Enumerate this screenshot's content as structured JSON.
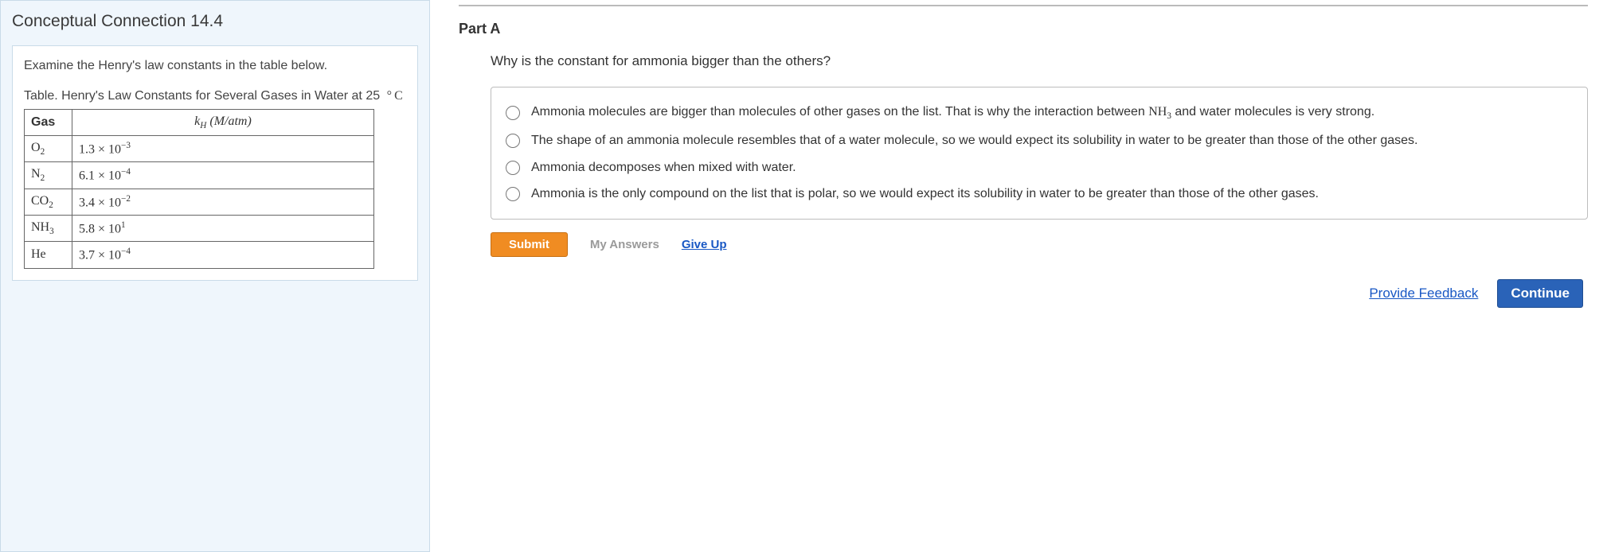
{
  "left": {
    "title": "Conceptual Connection 14.4",
    "instruction": "Examine the Henry's law constants in the table below.",
    "table_caption_prefix": "Table. Henry's Law Constants for Several Gases in Water at 25",
    "table_caption_unit": "°C",
    "headers": {
      "gas": "Gas",
      "kh": "kH (M/atm)"
    },
    "rows": [
      {
        "gas_base": "O",
        "gas_sub": "2",
        "val_coef": "1.3",
        "val_exp": "−3"
      },
      {
        "gas_base": "N",
        "gas_sub": "2",
        "val_coef": "6.1",
        "val_exp": "−4"
      },
      {
        "gas_base": "CO",
        "gas_sub": "2",
        "val_coef": "3.4",
        "val_exp": "−2"
      },
      {
        "gas_base": "NH",
        "gas_sub": "3",
        "val_coef": "5.8",
        "val_exp": "1"
      },
      {
        "gas_base": "He",
        "gas_sub": "",
        "val_coef": "3.7",
        "val_exp": "−4"
      }
    ]
  },
  "right": {
    "part_label": "Part A",
    "question": "Why is the constant for ammonia bigger than the others?",
    "choices": [
      {
        "pre": "Ammonia molecules are bigger than molecules of other gases on the list. That is why the interaction between ",
        "chem_base": "NH",
        "chem_sub": "3",
        "post": " and water molecules is very strong."
      },
      {
        "pre": "The shape of an ammonia molecule resembles that of a water molecule, so we would expect its solubility in water to be greater than those of the other gases.",
        "chem_base": "",
        "chem_sub": "",
        "post": ""
      },
      {
        "pre": "Ammonia decomposes when mixed with water.",
        "chem_base": "",
        "chem_sub": "",
        "post": ""
      },
      {
        "pre": "Ammonia is the only compound on the list that is polar, so we would expect its solubility in water to be greater than those of the other gases.",
        "chem_base": "",
        "chem_sub": "",
        "post": ""
      }
    ],
    "buttons": {
      "submit": "Submit",
      "my_answers": "My Answers",
      "give_up": "Give Up",
      "provide_feedback": "Provide Feedback",
      "continue": "Continue"
    }
  }
}
